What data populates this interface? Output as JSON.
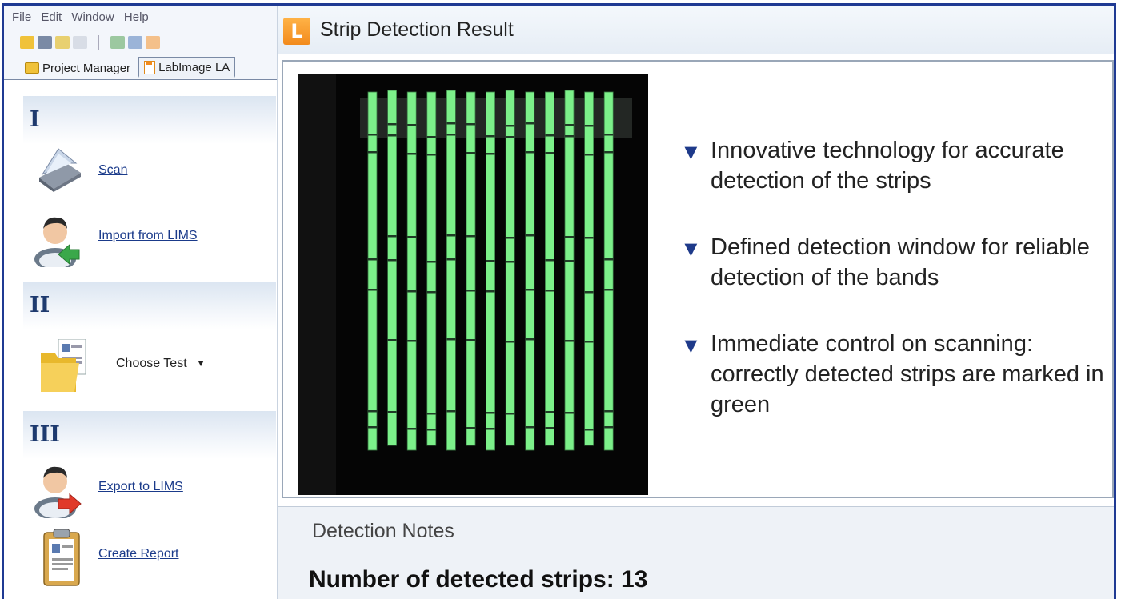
{
  "menu": [
    "File",
    "Edit",
    "Window",
    "Help"
  ],
  "tabs": {
    "project_manager": "Project Manager",
    "labimage": "LabImage LA"
  },
  "sections": {
    "one": {
      "numeral": "I",
      "scan": "Scan",
      "import": "Import from LIMS"
    },
    "two": {
      "numeral": "II",
      "choose_test": "Choose Test"
    },
    "three": {
      "numeral": "III",
      "export": "Export to LIMS",
      "report": "Create Report"
    }
  },
  "panel": {
    "logo": "L",
    "title": "Strip Detection Result"
  },
  "bullets": [
    "Innovative  technology for accurate detection of the strips",
    "Defined detection window for reliable detection of the bands",
    "Immediate control on scanning: correctly detected strips are marked in green"
  ],
  "bullet_marker": "▼",
  "notes": {
    "legend": "Detection Notes",
    "count_text": "Number of detected strips: 13"
  },
  "strips": {
    "count": 13,
    "color": "#7cf08a"
  }
}
